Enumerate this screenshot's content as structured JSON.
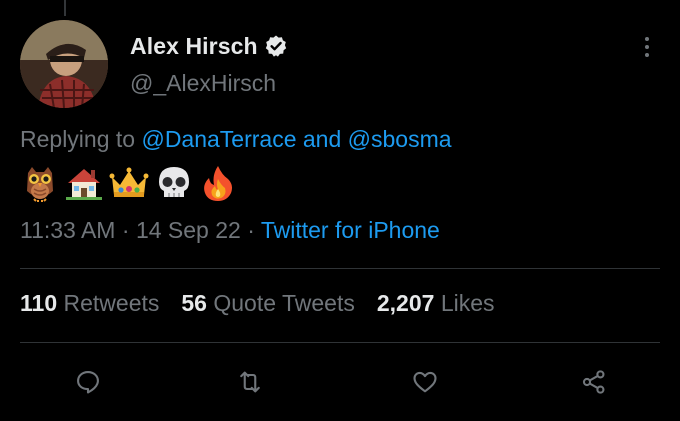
{
  "tweet": {
    "author": {
      "display_name": "Alex Hirsch",
      "handle": "@_AlexHirsch",
      "verified": true
    },
    "replying": {
      "prefix": "Replying to",
      "mention_1": "@DanaTerrace",
      "joiner": "and",
      "mention_2": "@sbosma"
    },
    "emojis": [
      "owl",
      "house",
      "crown",
      "skull",
      "fire"
    ],
    "time": "11:33 AM",
    "separator": "·",
    "date": "14 Sep 22",
    "source": "Twitter for iPhone"
  },
  "stats": {
    "retweets_count": "110",
    "retweets_label": "Retweets",
    "quotes_count": "56",
    "quotes_label": "Quote Tweets",
    "likes_count": "2,207",
    "likes_label": "Likes"
  },
  "actions": [
    "reply-icon",
    "retweet-icon",
    "like-icon",
    "share-icon"
  ],
  "colors": {
    "background": "#000000",
    "text": "#e7e9ea",
    "muted": "#71767b",
    "accent": "#1d9bf0",
    "divider": "#2f3336"
  }
}
